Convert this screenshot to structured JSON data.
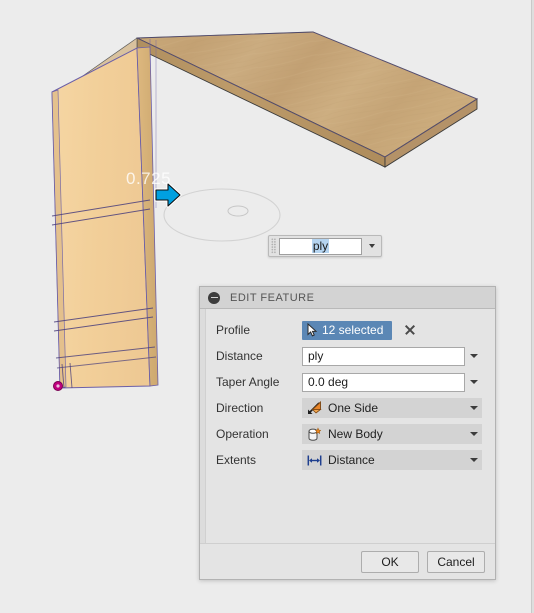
{
  "app": {
    "viewport_background": "#ececec"
  },
  "viewport": {
    "dimension_label": "0.725",
    "manipulator": {
      "icon": "arrow-right-manipulator",
      "color": "#00a0e0"
    },
    "origin_point": {
      "icon": "origin-point",
      "color": "#c0007f"
    },
    "bodies": [
      {
        "name": "top-shelf-panel",
        "material": "plywood",
        "color": "#c9a97a"
      },
      {
        "name": "side-panel",
        "material": "plywood",
        "color": "#f2cf99"
      }
    ]
  },
  "float_input": {
    "grip_icon": "drag-grip-icon",
    "value": "ply",
    "selected": true,
    "dropdown_icon": "chevron-down-icon"
  },
  "dialog": {
    "title": "EDIT FEATURE",
    "collapse_icon": "collapse-minus-icon",
    "rows": [
      {
        "label": "Profile",
        "type": "selection",
        "icon": "cursor-select-icon",
        "value": "12 selected",
        "clear_icon": "close-x-icon",
        "accent": "#5b87b5"
      },
      {
        "label": "Distance",
        "type": "text",
        "value": "ply",
        "dropdown_icon": "chevron-down-icon"
      },
      {
        "label": "Taper Angle",
        "type": "text",
        "value": "0.0 deg",
        "dropdown_icon": "chevron-down-icon"
      },
      {
        "label": "Direction",
        "type": "icon-select",
        "icon": "one-side-direction-icon",
        "value": "One Side",
        "dropdown_icon": "chevron-down-icon"
      },
      {
        "label": "Operation",
        "type": "icon-select",
        "icon": "new-body-icon",
        "value": "New Body",
        "dropdown_icon": "chevron-down-icon"
      },
      {
        "label": "Extents",
        "type": "icon-select",
        "icon": "distance-extent-icon",
        "value": "Distance",
        "dropdown_icon": "chevron-down-icon"
      }
    ],
    "buttons": {
      "ok": "OK",
      "cancel": "Cancel"
    }
  }
}
